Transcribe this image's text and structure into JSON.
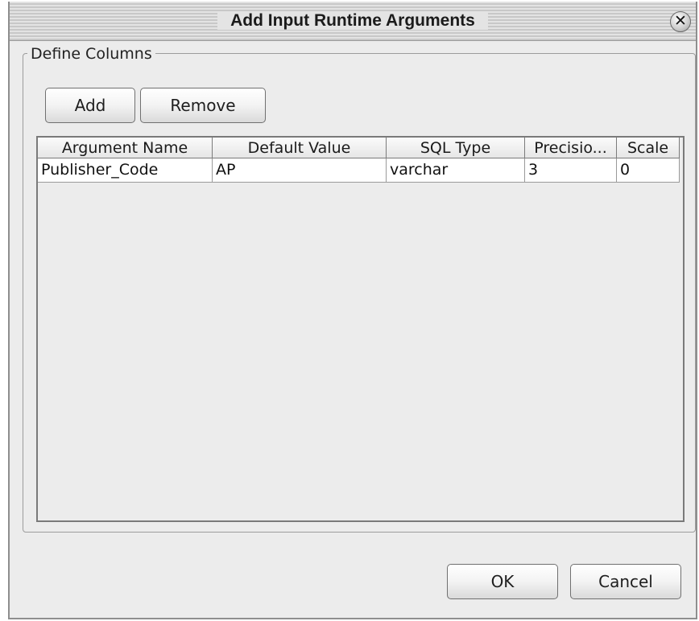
{
  "dialog": {
    "title": "Add Input Runtime Arguments",
    "close_icon": "close-icon"
  },
  "group": {
    "label": "Define Columns"
  },
  "toolbar": {
    "add_label": "Add",
    "remove_label": "Remove"
  },
  "table": {
    "columns": [
      "Argument Name",
      "Default Value",
      "SQL Type",
      "Precisio...",
      "Scale"
    ],
    "rows": [
      [
        "Publisher_Code",
        "AP",
        "varchar",
        "3",
        "0"
      ]
    ]
  },
  "footer": {
    "ok_label": "OK",
    "cancel_label": "Cancel"
  }
}
